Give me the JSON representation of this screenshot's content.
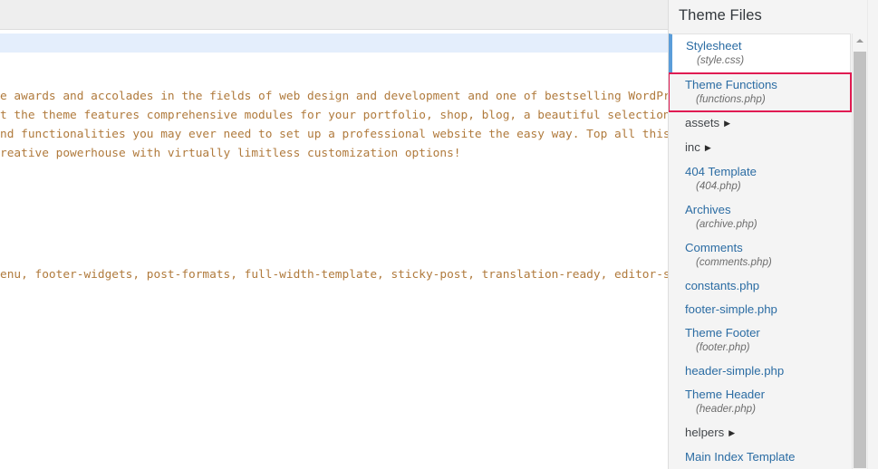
{
  "editor": {
    "toolbar_label": "",
    "code_lines": [
      "e awards and accolades in the fields of web design and development and one of bestselling WordPress",
      "t the theme features comprehensive modules for your portfolio, shop, blog, a beautiful selection of",
      "nd functionalities you may ever need to set up a professional website the easy way. Top all this off",
      "reative powerhouse with virtually limitless customization options!",
      "enu, footer-widgets, post-formats, full-width-template, sticky-post, translation-ready, editor-style"
    ],
    "code_text_color": "#b07a3c",
    "highlight_band_color": "#e4eefc"
  },
  "panel": {
    "title": "Theme Files",
    "accent_selected_color": "#5b9dd9",
    "accent_marked_color": "#e01b52",
    "link_color": "#2b6ca3",
    "scrollbar": {
      "up_arrow_icon": "triangle-up-icon",
      "thumb_label": "scroll-thumb"
    },
    "files": [
      {
        "title": "Stylesheet",
        "sub": "(style.css)",
        "state": "selected",
        "type": "file"
      },
      {
        "title": "Theme Functions",
        "sub": "(functions.php)",
        "state": "marked",
        "type": "file"
      },
      {
        "title": "assets",
        "sub": "",
        "state": "normal",
        "type": "folder"
      },
      {
        "title": "inc",
        "sub": "",
        "state": "normal",
        "type": "folder"
      },
      {
        "title": "404 Template",
        "sub": "(404.php)",
        "state": "normal",
        "type": "file"
      },
      {
        "title": "Archives",
        "sub": "(archive.php)",
        "state": "normal",
        "type": "file"
      },
      {
        "title": "Comments",
        "sub": "(comments.php)",
        "state": "normal",
        "type": "file"
      },
      {
        "title": "constants.php",
        "sub": "",
        "state": "normal",
        "type": "file"
      },
      {
        "title": "footer-simple.php",
        "sub": "",
        "state": "normal",
        "type": "file"
      },
      {
        "title": "Theme Footer",
        "sub": "(footer.php)",
        "state": "normal",
        "type": "file"
      },
      {
        "title": "header-simple.php",
        "sub": "",
        "state": "normal",
        "type": "file"
      },
      {
        "title": "Theme Header",
        "sub": "(header.php)",
        "state": "normal",
        "type": "file"
      },
      {
        "title": "helpers",
        "sub": "",
        "state": "normal",
        "type": "folder"
      },
      {
        "title": "Main Index Template",
        "sub": "",
        "state": "normal",
        "type": "file"
      }
    ],
    "folder_arrow_icon": "▶"
  }
}
